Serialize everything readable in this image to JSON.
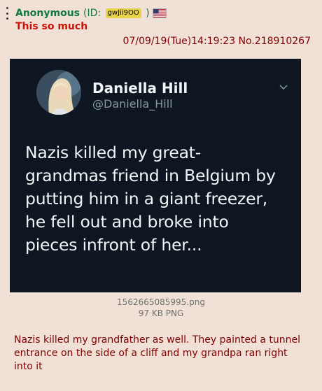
{
  "post": {
    "name": "Anonymous",
    "id_prefix": "(ID:",
    "id": "gwJii9OO",
    "id_suffix": ")",
    "flag": "us-flag-icon",
    "subject": "This so much",
    "datetime": "07/09/19(Tue)14:19:23",
    "post_no": "No.218910267",
    "file": {
      "name": "1562665085995.png",
      "meta": "97 KB PNG"
    },
    "comment": "Nazis killed my grandfather as well. They painted a tunnel entrance on the side of a cliff and my grandpa ran right into it"
  },
  "tweet": {
    "display_name": "Daniella Hill",
    "handle": "@Daniella_Hill",
    "lines": [
      "Nazis killed my great-",
      "grandmas friend in Belgium by",
      "putting him in a giant freezer,",
      "he fell out and broke into",
      "pieces infront of her..."
    ]
  },
  "colors": {
    "background": "#f0e0d6",
    "name_green": "#117743",
    "subject_red": "#cc1105",
    "text_maroon": "#800000",
    "tweet_bg": "#0d1621"
  }
}
